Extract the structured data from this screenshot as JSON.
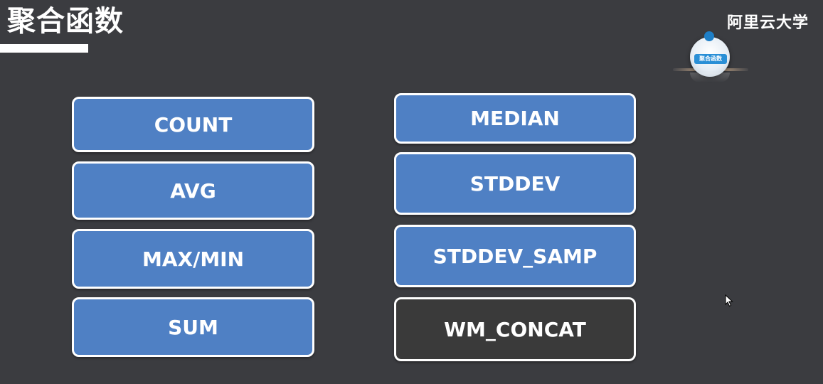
{
  "slide": {
    "title": "聚合函数",
    "brand": "阿里云大学",
    "logo_text": "聚合函数",
    "colors": {
      "background": "#3b3c40",
      "box_blue": "#4f80c4",
      "box_dark": "#3a3a3a",
      "border": "#ffffff"
    }
  },
  "functions": {
    "left": [
      "COUNT",
      "AVG",
      "MAX/MIN",
      "SUM"
    ],
    "right": [
      "MEDIAN",
      "STDDEV",
      "STDDEV_SAMP",
      "WM_CONCAT"
    ]
  }
}
